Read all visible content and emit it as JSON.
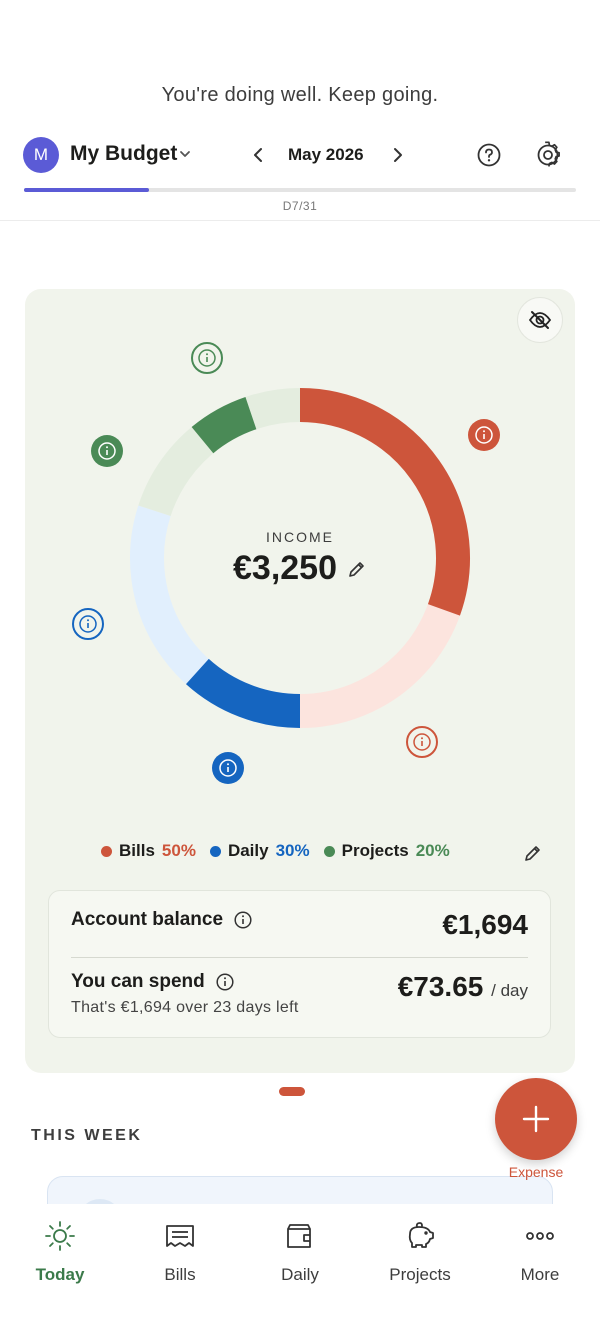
{
  "banner": "You're doing well. Keep going.",
  "header": {
    "avatar_letter": "M",
    "budget_name": "My Budget",
    "month": "May 2026",
    "day_label": "D7/31",
    "month_progress": 0.226
  },
  "income": {
    "label": "INCOME",
    "value": "€3,250"
  },
  "allocations": [
    {
      "name": "Bills",
      "percent": "50%",
      "color": "#cd553b",
      "spent_fraction": 0.61
    },
    {
      "name": "Daily",
      "percent": "30%",
      "color": "#1565c0",
      "spent_fraction": 0.39
    },
    {
      "name": "Projects",
      "percent": "20%",
      "color": "#4a8a56",
      "spent_fraction": 0.29
    }
  ],
  "balance": {
    "account_label": "Account balance",
    "account_value": "€1,694",
    "spend_label": "You can spend",
    "spend_sub": "That's €1,694 over 23 days left",
    "spend_value": "€73.65",
    "per_day": "/ day"
  },
  "fab": {
    "label": "Expense"
  },
  "section": {
    "this_week": "THIS WEEK"
  },
  "nav": [
    {
      "label": "Today",
      "icon": "sun-icon",
      "active": true
    },
    {
      "label": "Bills",
      "icon": "receipt-icon",
      "active": false
    },
    {
      "label": "Daily",
      "icon": "wallet-icon",
      "active": false
    },
    {
      "label": "Projects",
      "icon": "piggy-bank-icon",
      "active": false
    },
    {
      "label": "More",
      "icon": "more-dots-icon",
      "active": false
    }
  ],
  "colors": {
    "accent": "#5b5bd6",
    "bills": "#cd553b",
    "daily": "#1565c0",
    "projects": "#4a8a56",
    "card_bg": "#f1f4ec"
  }
}
